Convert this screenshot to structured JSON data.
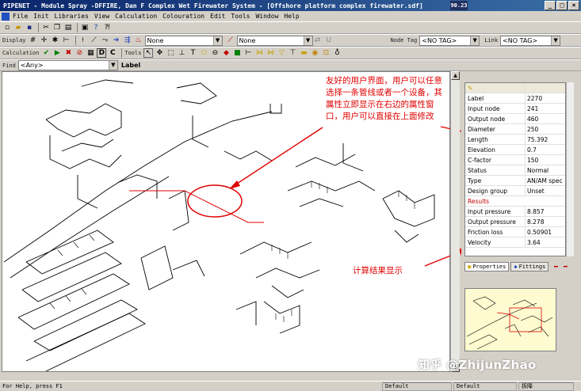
{
  "window": {
    "title": "PIPENET - Module Spray -DFFIRE, Dan F Complex Wet Firewater System - [Offshore platform complex firewater.sdf]",
    "badge": "90.23"
  },
  "menu": [
    "File",
    "Init",
    "Libraries",
    "View",
    "Calculation",
    "Colouration",
    "Edit",
    "Tools",
    "Window",
    "Help"
  ],
  "toolbar_display": {
    "label": "Display",
    "combo1": "None",
    "combo2": "None",
    "u_label": "U",
    "node_tag_label": "Node Tag",
    "node_tag_value": "<NO TAG>",
    "link_label": "Link",
    "link_value": "<NO TAG>"
  },
  "toolbar_calc": {
    "label": "Calculation",
    "letters": [
      "D",
      "C"
    ],
    "tools_label": "Tools"
  },
  "findbar": {
    "label": "Find",
    "value": "<Any>",
    "label_field": "Label"
  },
  "properties": {
    "rows": [
      {
        "k": "Label",
        "v": "2270"
      },
      {
        "k": "Input node",
        "v": "241"
      },
      {
        "k": "Output node",
        "v": "460"
      },
      {
        "k": "Diameter",
        "v": "250"
      },
      {
        "k": "Length",
        "v": "75.392"
      },
      {
        "k": "Elevation",
        "v": "0.7"
      },
      {
        "k": "C-factor",
        "v": "150"
      },
      {
        "k": "Status",
        "v": "Normal"
      },
      {
        "k": "Type",
        "v": "AN/AM spec"
      },
      {
        "k": "Design group",
        "v": "Unset"
      }
    ],
    "results_label": "Results",
    "results": [
      {
        "k": "Input pressure",
        "v": "8.857"
      },
      {
        "k": "Output pressure",
        "v": "8.278"
      },
      {
        "k": "Friction loss",
        "v": "0.50901"
      },
      {
        "k": "Velocity",
        "v": "3.64"
      }
    ],
    "tabs": [
      "Properties",
      "Fittings"
    ]
  },
  "annotations": {
    "top": "友好的用户界面，用户可以任意选择一条管线或者一个设备，其属性立即显示在右边的属性窗口，用户可以直接在上面修改",
    "bottom": "计算结果显示"
  },
  "statusbar": {
    "help": "For Help, press F1",
    "c1": "Default",
    "c2": "Default",
    "c3": "拆降"
  },
  "watermark": "知乎 @ZhijunZhao",
  "colors": {
    "titlebar": "#0a246a",
    "annotation": "#e00000",
    "overview_bg": "#fffbd0"
  }
}
